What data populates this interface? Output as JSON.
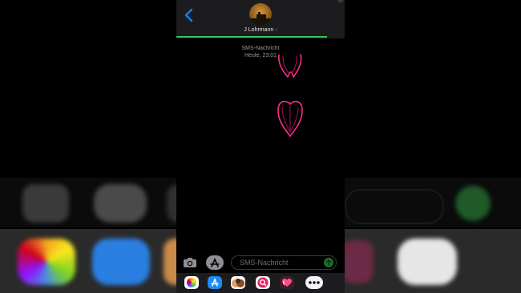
{
  "conversation": {
    "contact_name": "J Lohrmann",
    "chevron": "›",
    "channel_label": "SMS-Nachricht",
    "timestamp": "Heute, 23:01"
  },
  "compose": {
    "placeholder": "SMS-Nachricht"
  },
  "messages": [
    {
      "type": "digital-touch-heart",
      "color": "#ff2d8a"
    },
    {
      "type": "digital-touch-heart",
      "color": "#ff2d8a"
    }
  ],
  "app_drawer": {
    "items": [
      "photos-icon",
      "app-store-icon",
      "memoji-icon",
      "image-search-icon",
      "digital-touch-icon",
      "more-icon"
    ]
  },
  "colors": {
    "accent": "#0a84ff",
    "progress": "#34c759",
    "heart": "#ff2d8a"
  }
}
